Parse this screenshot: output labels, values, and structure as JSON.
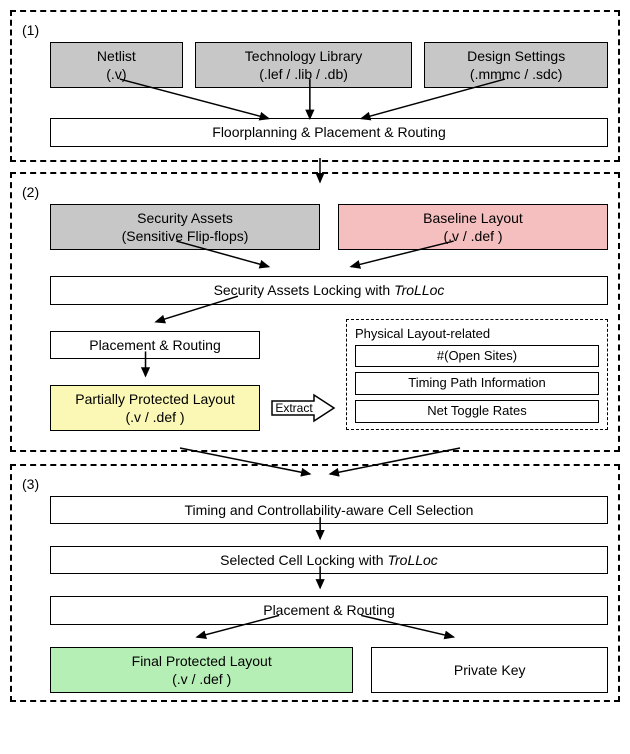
{
  "section1": {
    "label": "(1)",
    "netlist": "Netlist\n(.v)",
    "techlib": "Technology Library\n(.lef / .lib / .db)",
    "settings": "Design Settings\n(.mmmc / .sdc)",
    "floorplan": "Floorplanning & Placement & Routing"
  },
  "section2": {
    "label": "(2)",
    "assets": "Security Assets\n(Sensitive Flip-flops)",
    "baseline": "Baseline Layout\n(.v / .def )",
    "locking_pre": "Security Assets Locking with ",
    "locking_ital": "TroLLoc",
    "pr": "Placement & Routing",
    "partial": "Partially Protected Layout\n(.v / .def )",
    "extract": "Extract",
    "phys_title": "Physical Layout-related",
    "open_sites": "#(Open Sites)",
    "timing": "Timing Path Information",
    "toggle": "Net Toggle Rates"
  },
  "section3": {
    "label": "(3)",
    "cellsel": "Timing and Controllability-aware Cell Selection",
    "locking_pre": "Selected Cell Locking with ",
    "locking_ital": "TroLLoc",
    "pr": "Placement & Routing",
    "final": "Final Protected Layout\n(.v / .def )",
    "key": "Private Key"
  }
}
